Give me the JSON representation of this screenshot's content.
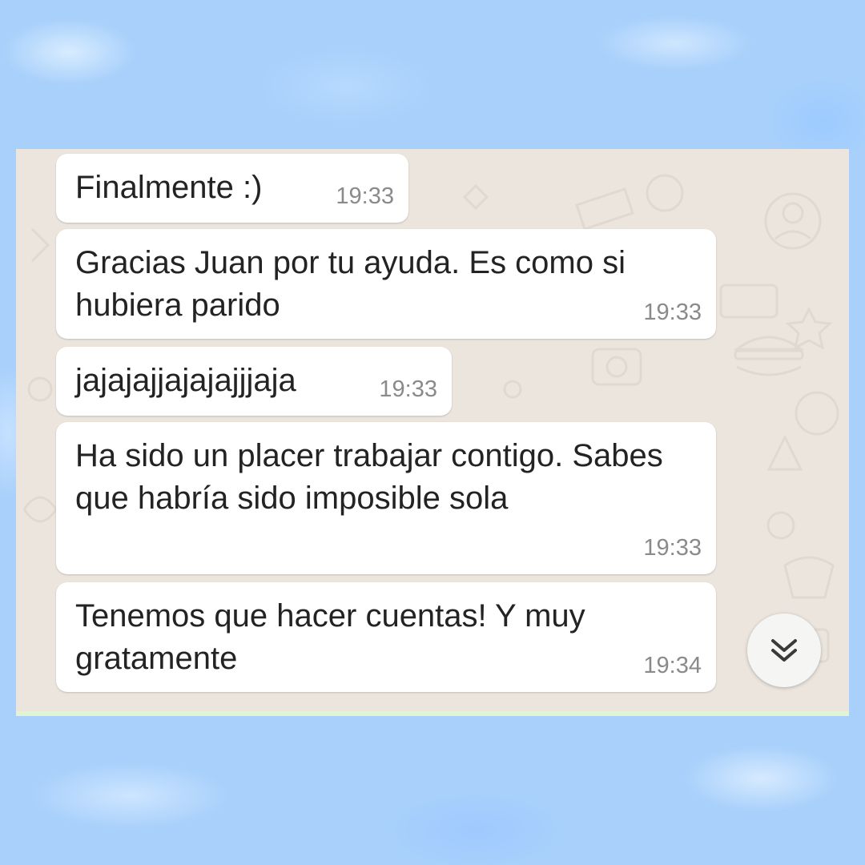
{
  "chat": {
    "messages": [
      {
        "text": "Finalmente :)",
        "time": "19:33"
      },
      {
        "text": "Gracias Juan por tu ayuda. Es como si hubiera parido",
        "time": "19:33"
      },
      {
        "text": "jajajajjajajajjjaja",
        "time": "19:33"
      },
      {
        "text": "Ha sido un placer trabajar contigo. Sabes que habría sido imposible sola",
        "time": "19:33"
      },
      {
        "text": "Tenemos que hacer cuentas! Y muy gratamente",
        "time": "19:34"
      }
    ],
    "scroll_button_icon": "double-chevron-down-icon"
  },
  "colors": {
    "page_background": "#a8d0fb",
    "chat_background": "#ece5dd",
    "bubble": "#ffffff",
    "timestamp": "#8a8a8a"
  }
}
